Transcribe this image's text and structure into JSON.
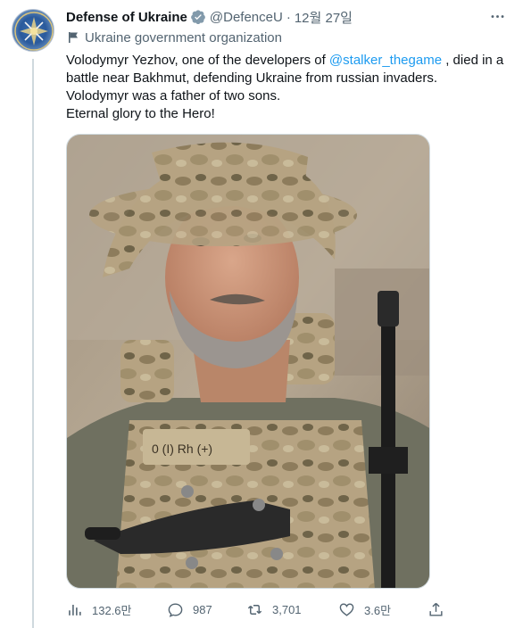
{
  "tweet": {
    "author": {
      "display_name": "Defense of Ukraine",
      "handle": "@DefenceU",
      "verified_icon": "verified-badge-icon",
      "affiliation": "Ukraine government organization"
    },
    "separator": "·",
    "date": "12월 27일",
    "text": {
      "line1_before": "Volodymyr Yezhov, one of the developers of ",
      "mention": "@stalker_thegame",
      "line1_after": " , died in a",
      "line2": "battle near Bakhmut, defending Ukraine from russian invaders.",
      "line3": "Volodymyr was a father of two sons.",
      "line4": "Eternal glory to the Hero!"
    },
    "media": {
      "patch_text": "0 (I) Rh (+)"
    },
    "stats": {
      "views": "132.6만",
      "replies": "987",
      "retweets": "3,701",
      "likes": "3.6만"
    }
  },
  "colors": {
    "text_primary": "#0f1419",
    "text_secondary": "#536471",
    "link": "#1d9bf0",
    "thread_line": "#cfd9de"
  }
}
